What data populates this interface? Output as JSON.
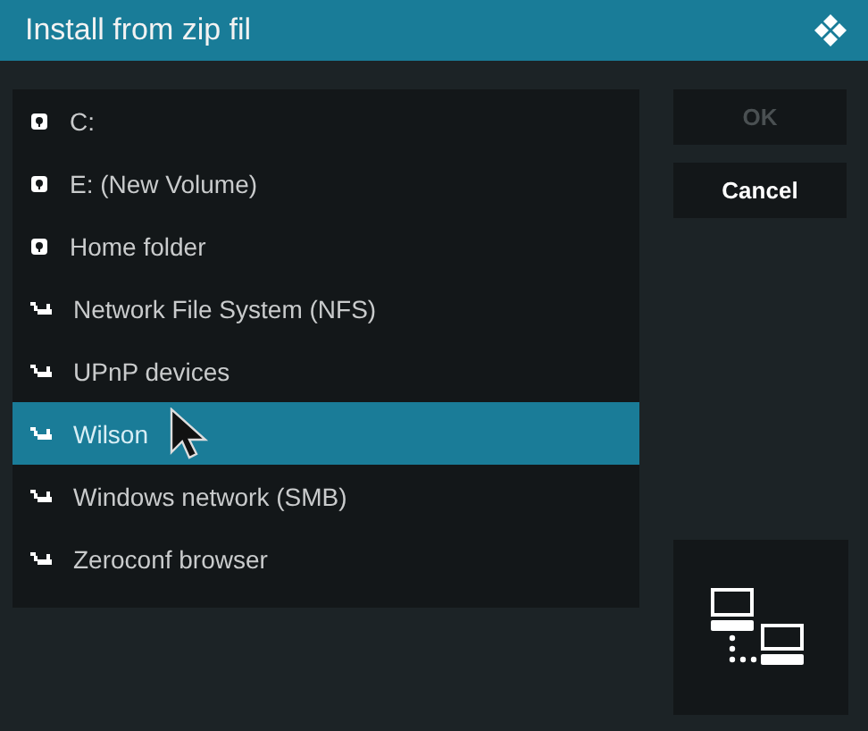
{
  "window": {
    "title": "Install from zip fil"
  },
  "sources": [
    {
      "label": "C:",
      "kind": "drive",
      "selected": false
    },
    {
      "label": "E: (New Volume)",
      "kind": "drive",
      "selected": false
    },
    {
      "label": "Home folder",
      "kind": "drive",
      "selected": false
    },
    {
      "label": "Network File System (NFS)",
      "kind": "network",
      "selected": false
    },
    {
      "label": "UPnP devices",
      "kind": "network",
      "selected": false
    },
    {
      "label": "Wilson",
      "kind": "network",
      "selected": true
    },
    {
      "label": "Windows network (SMB)",
      "kind": "network",
      "selected": false
    },
    {
      "label": "Zeroconf browser",
      "kind": "network",
      "selected": false
    }
  ],
  "buttons": [
    {
      "label": "OK",
      "disabled": true
    },
    {
      "label": "Cancel",
      "disabled": false
    }
  ]
}
